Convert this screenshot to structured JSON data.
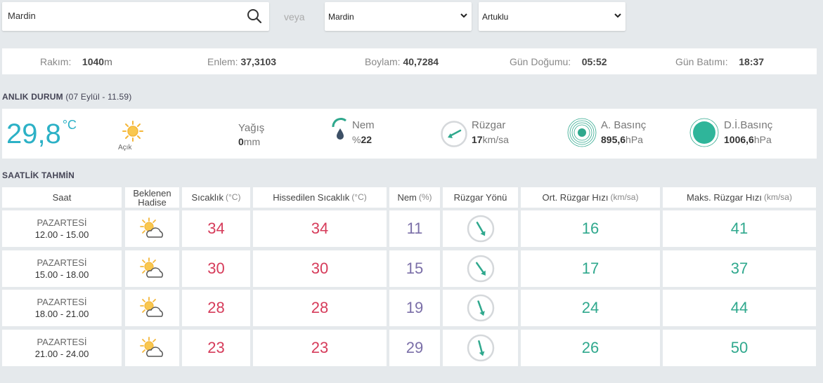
{
  "search": {
    "value": "Mardin"
  },
  "or_label": "veya",
  "province_select": {
    "value": "Mardin"
  },
  "district_select": {
    "value": "Artuklu"
  },
  "info": {
    "altitude": {
      "label": "Rakım:",
      "value": "1040",
      "unit": "m"
    },
    "latitude": {
      "label": "Enlem:",
      "value": "37,3103"
    },
    "longitude": {
      "label": "Boylam:",
      "value": "40,7284"
    },
    "sunrise": {
      "label": "Gün Doğumu:",
      "value": "05:52"
    },
    "sunset": {
      "label": "Gün Batımı:",
      "value": "18:37"
    }
  },
  "current": {
    "title": "ANLIK DURUM",
    "date": "(07 Eylül - 11.59)",
    "temperature": "29,8",
    "temperature_unit": "°C",
    "condition": "Açık",
    "precip": {
      "label": "Yağış",
      "value": "0",
      "unit": "mm"
    },
    "humidity": {
      "label": "Nem",
      "prefix": "%",
      "value": "22"
    },
    "wind": {
      "label": "Rüzgar",
      "value": "17",
      "unit": "km/sa"
    },
    "pressure": {
      "label": "A. Basınç",
      "value": "895,6",
      "unit": "hPa"
    },
    "sea_pressure": {
      "label": "D.İ.Basınç",
      "value": "1006,6",
      "unit": "hPa"
    }
  },
  "forecast": {
    "title": "SAATLİK TAHMİN",
    "headers": {
      "time": "Saat",
      "event_1": "Beklenen",
      "event_2": "Hadise",
      "temp": "Sıcaklık",
      "temp_unit": "(°C)",
      "feels": "Hissedilen Sıcaklık",
      "feels_unit": "(°C)",
      "humidity": "Nem",
      "humidity_unit": "(%)",
      "wind_dir": "Rüzgar Yönü",
      "avg_wind": "Ort. Rüzgar Hızı",
      "avg_wind_unit": "(km/sa)",
      "max_wind": "Maks. Rüzgar Hızı",
      "max_wind_unit": "(km/sa)"
    },
    "rows": [
      {
        "day": "PAZARTESİ",
        "time": "12.00 - 15.00",
        "temp": "34",
        "feels": "34",
        "humidity": "11",
        "avg_wind": "16",
        "max_wind": "41"
      },
      {
        "day": "PAZARTESİ",
        "time": "15.00 - 18.00",
        "temp": "30",
        "feels": "30",
        "humidity": "15",
        "avg_wind": "17",
        "max_wind": "37"
      },
      {
        "day": "PAZARTESİ",
        "time": "18.00 - 21.00",
        "temp": "28",
        "feels": "28",
        "humidity": "19",
        "avg_wind": "24",
        "max_wind": "44"
      },
      {
        "day": "PAZARTESİ",
        "time": "21.00 - 24.00",
        "temp": "23",
        "feels": "23",
        "humidity": "29",
        "avg_wind": "26",
        "max_wind": "50"
      }
    ]
  }
}
